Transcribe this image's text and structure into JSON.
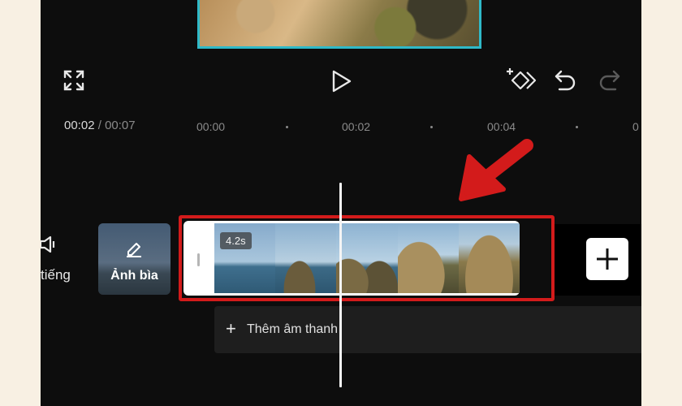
{
  "timecode": {
    "current": "00:02",
    "separator": "/",
    "total": "00:07"
  },
  "ruler": {
    "marks": [
      "00:00",
      "00:02",
      "00:04",
      "0"
    ]
  },
  "tools": {
    "mute_label": "tiếng",
    "cover_label": "Ảnh bìa"
  },
  "clip": {
    "duration": "4.2s"
  },
  "audio": {
    "plus": "+",
    "label": "Thêm âm thanh"
  },
  "colors": {
    "highlight": "#d31b1b",
    "preview_border": "#2fb9c8",
    "background": "#0d0d0d"
  },
  "icons": [
    "fullscreen-icon",
    "play-icon",
    "keyframe-add-icon",
    "undo-icon",
    "redo-icon",
    "speaker-icon",
    "edit-icon",
    "add-icon",
    "red-arrow-icon"
  ]
}
